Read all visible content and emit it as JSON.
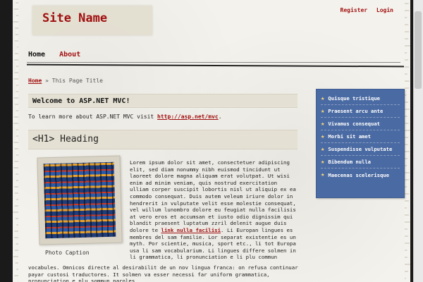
{
  "header": {
    "site_name": "Site Name",
    "register": "Register",
    "login": "Login"
  },
  "nav": {
    "home": "Home",
    "about": "About"
  },
  "breadcrumb": {
    "home": "Home",
    "separator": "»",
    "current": "This Page Title"
  },
  "welcome": {
    "title": "Welcome to ASP.NET MVC!",
    "intro_prefix": "To learn more about ASP.NET MVC visit",
    "intro_link": "http://asp.net/mvc",
    "intro_suffix": "."
  },
  "heading": "<H1> Heading",
  "photo": {
    "caption": "Photo Caption"
  },
  "article": {
    "text_before_link": "Lorem ipsum dolor sit amet, consectetuer adipiscing elit, sed diam nonummy nibh euismod tincidunt ut laoreet dolore magna aliquam erat volutpat. Ut wisi enim ad minim veniam, quis nostrud exercitation ulliam corper suscipit lobortis nisl ut aliquip ex ea commodo consequat. Duis autem veleum iriure dolor in hendrerit in vulputate velit esse molestie consequat, vel willum lunombro dolore eu feugiat nulla facilisis at vero eros et accumsan et iusto odio dignissim qui blandit praesent luptatum zzril delenit augue duis dolore te",
    "link": "link nulla facilisi",
    "text_after_link": ". Li Europan lingues es membres del sam familie. Lor separat existentie es un myth. Por scientie, musica, sport etc., li tot Europa usa li sam vocabularium. Li lingues differe solmen in li grammatica, li pronunciation e li plu commun",
    "text_continued": "vocabules. Omnicos directe al desirabilit de un nov lingua franca: on refusa continuar payar custosi traductores. It solmen va esser necessi far uniform grammatica, pronunciation e plu sommun paroles."
  },
  "sidebar": {
    "items": [
      "Quisque tristique",
      "Praesent arcu ante",
      "Vivamus consequat",
      "Morbi sit amet",
      "Suspendisse vulputate",
      "Bibendum nulla",
      "Maecenas scelerisque"
    ]
  }
}
